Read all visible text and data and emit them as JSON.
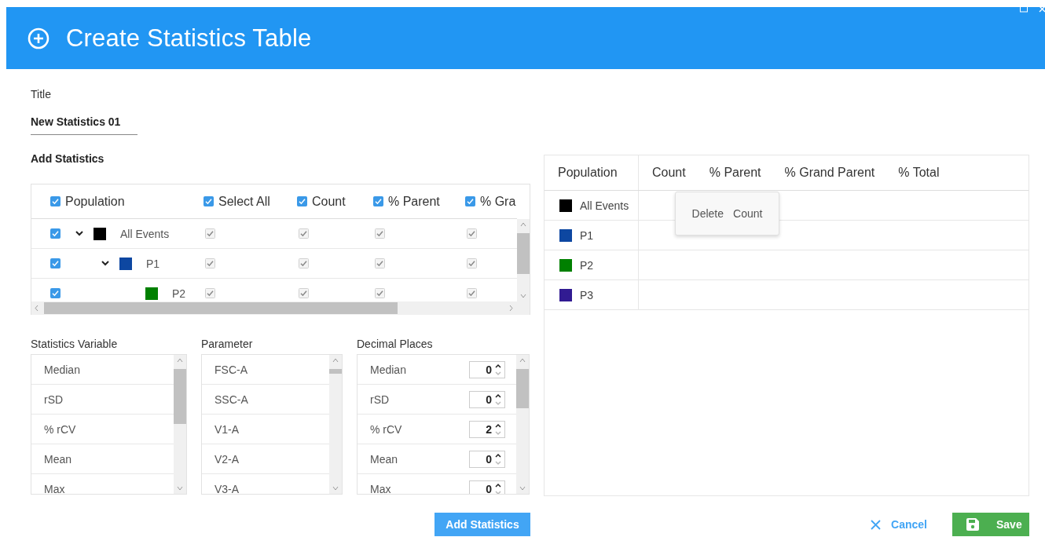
{
  "dialog": {
    "title": "Create Statistics Table"
  },
  "title_field": {
    "label": "Title",
    "value": "New Statistics 01"
  },
  "add_statistics": {
    "heading": "Add Statistics",
    "tree": {
      "columns": [
        {
          "label": "Population",
          "checked": true
        },
        {
          "label": "Select All",
          "checked": true
        },
        {
          "label": "Count",
          "checked": true
        },
        {
          "label": "% Parent",
          "checked": true
        },
        {
          "label": "% Gra",
          "checked": true
        }
      ],
      "rows": [
        {
          "name": "All Events",
          "color": "#000000",
          "checked": true,
          "expanded": true,
          "stats": [
            {
              "checked": true
            },
            {
              "checked": true
            },
            {
              "checked": true
            },
            {
              "checked": true
            }
          ],
          "children": [
            {
              "name": "P1",
              "color": "#0d47a1",
              "checked": true,
              "expanded": true,
              "stats": [
                {
                  "checked": true
                },
                {
                  "checked": true
                },
                {
                  "checked": true
                },
                {
                  "checked": true
                }
              ],
              "children": [
                {
                  "name": "P2",
                  "color": "#008000",
                  "checked": true,
                  "stats": [
                    {
                      "checked": true
                    },
                    {
                      "checked": true
                    },
                    {
                      "checked": true
                    },
                    {
                      "checked": true
                    }
                  ]
                }
              ]
            }
          ]
        }
      ]
    }
  },
  "statistics_variable": {
    "label": "Statistics Variable",
    "items": [
      "Median",
      "rSD",
      "% rCV",
      "Mean",
      "Max"
    ]
  },
  "parameter": {
    "label": "Parameter",
    "items": [
      "FSC-A",
      "SSC-A",
      "V1-A",
      "V2-A",
      "V3-A"
    ]
  },
  "decimal_places": {
    "label": "Decimal Places",
    "items": [
      {
        "name": "Median",
        "value": "0"
      },
      {
        "name": "rSD",
        "value": "0"
      },
      {
        "name": "% rCV",
        "value": "2"
      },
      {
        "name": "Mean",
        "value": "0"
      },
      {
        "name": "Max",
        "value": "0"
      }
    ]
  },
  "add_button": "Add Statistics",
  "result_table": {
    "columns": [
      "Population",
      "Count",
      "% Parent",
      "% Grand Parent",
      "% Total"
    ],
    "rows": [
      {
        "name": "All Events",
        "color": "#000000"
      },
      {
        "name": "P1",
        "color": "#0d47a1"
      },
      {
        "name": "P2",
        "color": "#008000"
      },
      {
        "name": "P3",
        "color": "#311b92"
      }
    ]
  },
  "context_menu": {
    "action": "Delete",
    "target": "Count"
  },
  "footer": {
    "cancel": "Cancel",
    "save": "Save"
  }
}
